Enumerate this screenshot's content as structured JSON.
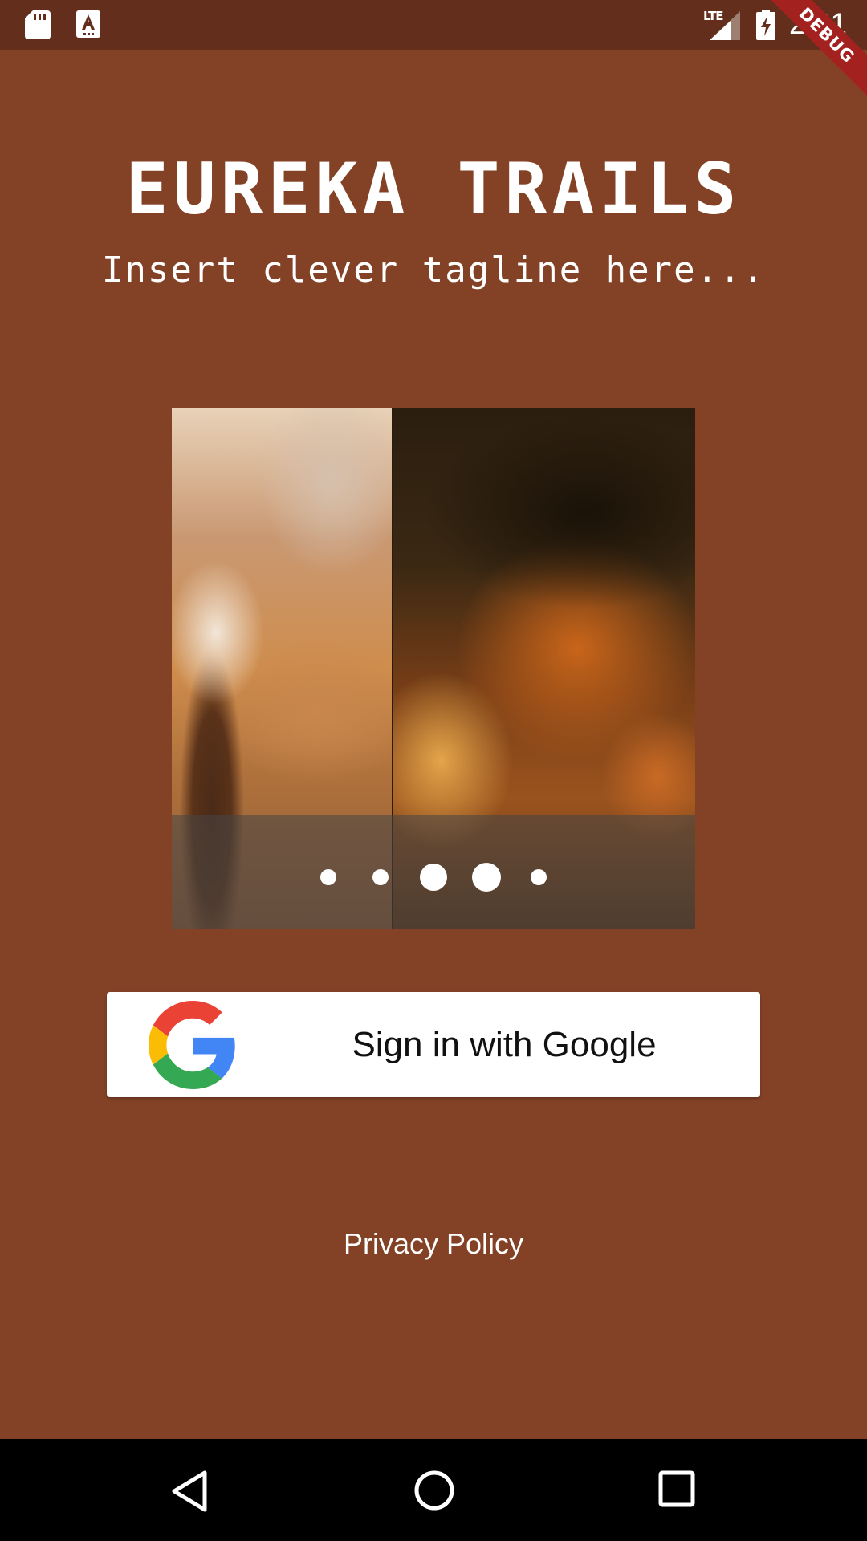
{
  "status_bar": {
    "network": "LTE",
    "time": "2:01",
    "left_icons": [
      "sd-card-icon",
      "text-a-icon"
    ],
    "right_icons": [
      "signal-icon",
      "battery-charging-icon"
    ]
  },
  "debug_banner": "DEBUG",
  "header": {
    "title": "EUREKA TRAILS",
    "tagline": "Insert clever tagline here..."
  },
  "carousel": {
    "slide_count": 5,
    "active_index": 3,
    "images": [
      "pixel-art-adventurer-canyon",
      "pixel-art-man-portrait"
    ]
  },
  "sign_in": {
    "label": "Sign in with Google",
    "icon": "google-g-icon"
  },
  "privacy_link": "Privacy Policy",
  "colors": {
    "background": "#834226",
    "status_bar": "#632e1b",
    "debug_ribbon": "#a3211e",
    "button_bg": "#ffffff"
  },
  "nav_bar": {
    "icons": [
      "back-icon",
      "home-icon",
      "recents-icon"
    ]
  }
}
